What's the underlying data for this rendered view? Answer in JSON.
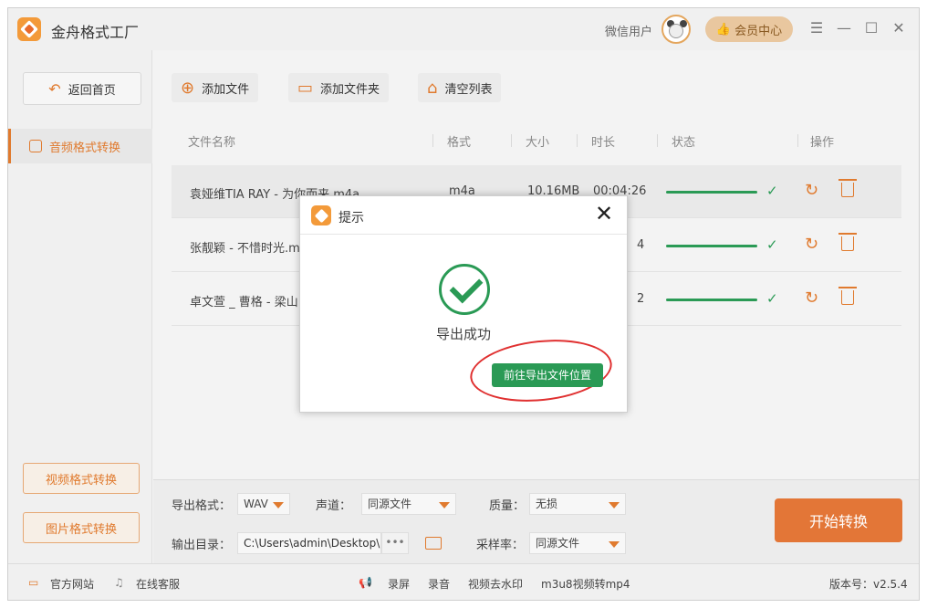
{
  "app": {
    "title": "金舟格式工厂",
    "user_label": "微信用户",
    "vip_label": "会员中心",
    "window_controls": [
      "☰",
      "—",
      "☐",
      "✕"
    ]
  },
  "sidebar": {
    "home_label": "返回首页",
    "active_item": "音频格式转换",
    "video_btn": "视频格式转换",
    "image_btn": "图片格式转换"
  },
  "toolbar": {
    "add_file": "添加文件",
    "add_folder": "添加文件夹",
    "clear_list": "清空列表"
  },
  "table": {
    "headers": [
      "文件名称",
      "格式",
      "大小",
      "时长",
      "状态",
      "操作"
    ],
    "rows": [
      {
        "name": "袁娅维TIA RAY - 为你而来.m4a",
        "format": "m4a",
        "size": "10.16MB",
        "duration": "00:04:26",
        "progress": 1.0
      },
      {
        "name": "张靓颖 - 不惜时光.m",
        "format": "",
        "size": "",
        "duration": "4",
        "progress": 1.0
      },
      {
        "name": "卓文萱 _ 曹格 - 梁山",
        "format": "",
        "size": "",
        "duration": "2",
        "progress": 1.0
      }
    ]
  },
  "settings": {
    "out_format_label": "导出格式：",
    "out_format_value": "WAV",
    "channel_label": "声道：",
    "channel_value": "同源文件",
    "quality_label": "质量：",
    "quality_value": "无损",
    "out_dir_label": "输出目录：",
    "out_dir_value": "C:\\Users\\admin\\Desktop\\",
    "dots": "•••",
    "sample_rate_label": "采样率：",
    "sample_rate_value": "同源文件",
    "start_label": "开始转换"
  },
  "statusbar": {
    "website": "官方网站",
    "service": "在线客服",
    "record": "录屏",
    "audio_record": "录音",
    "watermark": "视频去水印",
    "m3u8": "m3u8视频转mp4",
    "version": "版本号：v2.5.4"
  },
  "dialog": {
    "title": "提示",
    "message": "导出成功",
    "goto_button": "前往导出文件位置",
    "close_glyph": "✕"
  }
}
